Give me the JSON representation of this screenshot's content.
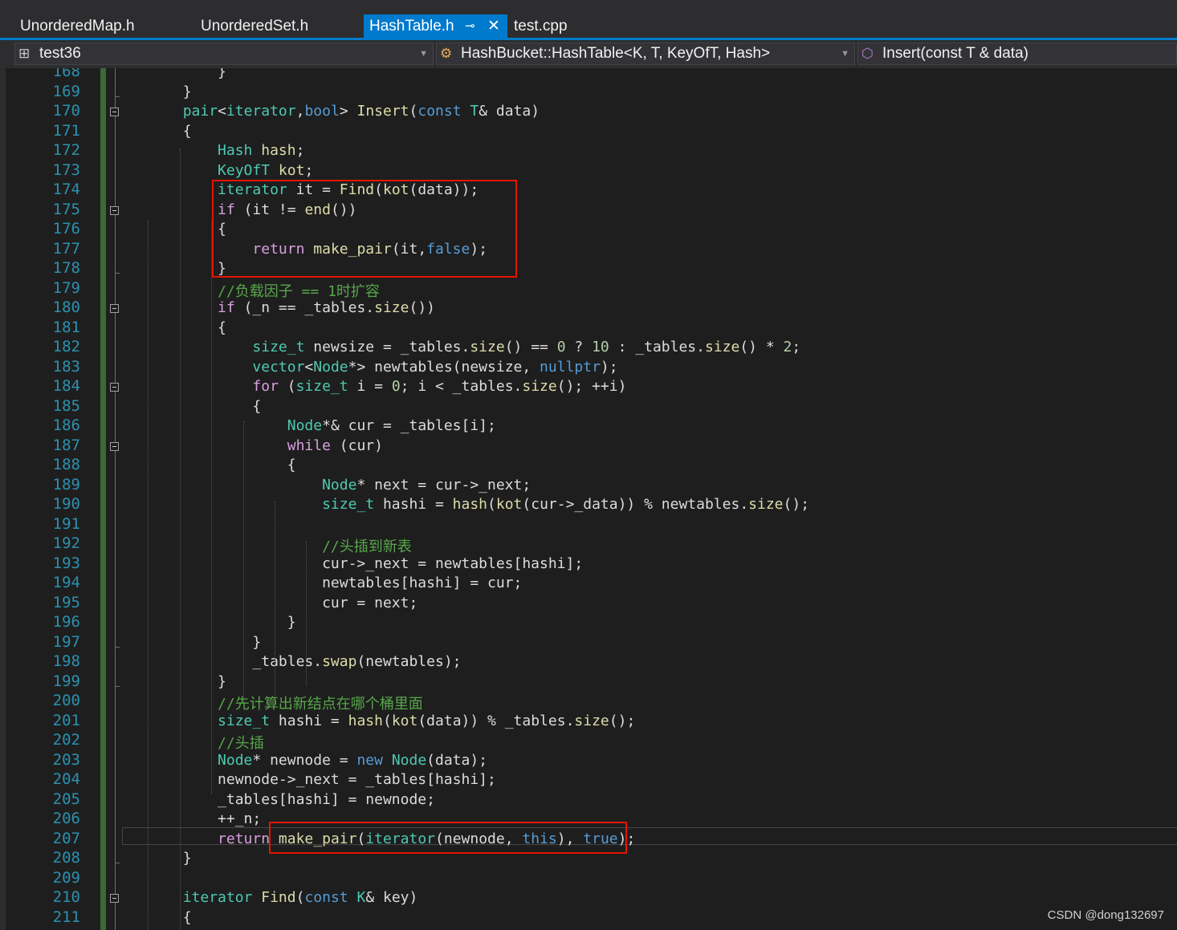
{
  "tabs": [
    {
      "label": "UnorderedMap.h",
      "active": false
    },
    {
      "label": "UnorderedSet.h",
      "active": false
    },
    {
      "label": "HashTable.h",
      "active": true
    },
    {
      "label": "test.cpp",
      "active": false
    }
  ],
  "tab_icons": {
    "pin": "pin-icon",
    "close": "close-icon"
  },
  "nav": {
    "project": "test36",
    "scope": "HashBucket::HashTable<K, T, KeyOfT, Hash>",
    "member": "Insert(const T & data)"
  },
  "line_numbers": [
    "168",
    "169",
    "170",
    "171",
    "172",
    "173",
    "174",
    "175",
    "176",
    "177",
    "178",
    "179",
    "180",
    "181",
    "182",
    "183",
    "184",
    "185",
    "186",
    "187",
    "188",
    "189",
    "190",
    "191",
    "192",
    "193",
    "194",
    "195",
    "196",
    "197",
    "198",
    "199",
    "200",
    "201",
    "202",
    "203",
    "204",
    "205",
    "206",
    "207",
    "208",
    "209",
    "210",
    "211"
  ],
  "code_lines": [
    "            }",
    "        }",
    "        pair<iterator,bool> Insert(const T& data)",
    "        {",
    "            Hash hash;",
    "            KeyOfT kot;",
    "            iterator it = Find(kot(data));",
    "            if (it != end())",
    "            {",
    "                return make_pair(it,false);",
    "            }",
    "            //负载因子 == 1时扩容",
    "            if (_n == _tables.size())",
    "            {",
    "                size_t newsize = _tables.size() == 0 ? 10 : _tables.size() * 2;",
    "                vector<Node*> newtables(newsize, nullptr);",
    "                for (size_t i = 0; i < _tables.size(); ++i)",
    "                {",
    "                    Node*& cur = _tables[i];",
    "                    while (cur)",
    "                    {",
    "                        Node* next = cur->_next;",
    "                        size_t hashi = hash(kot(cur->_data)) % newtables.size();",
    "",
    "                        //头插到新表",
    "                        cur->_next = newtables[hashi];",
    "                        newtables[hashi] = cur;",
    "                        cur = next;",
    "                    }",
    "                }",
    "                _tables.swap(newtables);",
    "            }",
    "            //先计算出新结点在哪个桶里面",
    "            size_t hashi = hash(kot(data)) % _tables.size();",
    "            //头插",
    "            Node* newnode = new Node(data);",
    "            newnode->_next = _tables[hashi];",
    "            _tables[hashi] = newnode;",
    "            ++_n;",
    "            return make_pair(iterator(newnode, this), true);",
    "        }",
    "",
    "        iterator Find(const K& key)",
    "        {"
  ],
  "colors": {
    "keyword": "#569cd6",
    "type": "#4ec9b0",
    "function": "#dcdcaa",
    "comment": "#57a64a",
    "control": "#d8a0df",
    "line_number": "#2b91af",
    "highlight_box": "#e51400"
  },
  "watermark": "CSDN @dong132697"
}
